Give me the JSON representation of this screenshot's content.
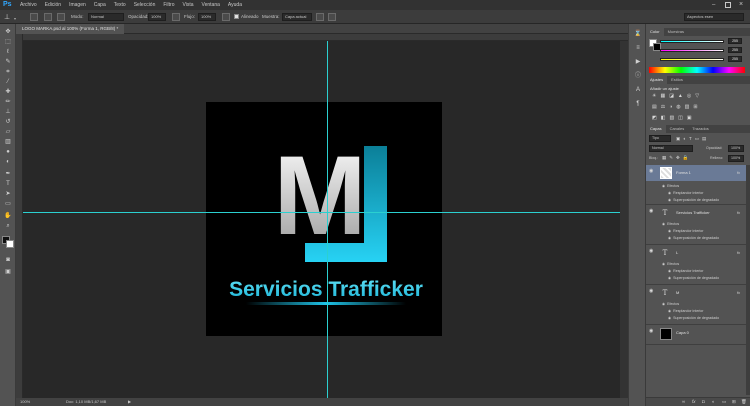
{
  "menubar": {
    "logo": "Ps",
    "items": [
      "Archivo",
      "Edición",
      "Imagen",
      "Capa",
      "Texto",
      "Selección",
      "Filtro",
      "Vista",
      "Ventana",
      "Ayuda"
    ]
  },
  "options": {
    "modo_label": "Modo:",
    "modo_value": "Normal",
    "opacidad_label": "Opacidad:",
    "opacidad_value": "100%",
    "flujo_label": "Flujo:",
    "flujo_value": "100%",
    "alineado_label": "Alineado",
    "muestra_label": "Muestra:",
    "muestra_value": "Capa actual",
    "workspace_value": "Aspectos esen"
  },
  "document": {
    "tab_title": "LOGO MARKA.psd al 100% (Forma 1, RGB/8) *",
    "zoom": "100%",
    "doc_info": "Doc: 1,10 MB/1,67 MB"
  },
  "artwork": {
    "mark_text": "M",
    "brand_text": "Servicios Trafficker"
  },
  "panels": {
    "color_tabs": [
      "Color",
      "Muestras"
    ],
    "color_values": [
      "255",
      "255",
      "255"
    ],
    "ajustes_tabs": [
      "Ajustes",
      "Estilos"
    ],
    "ajustes_title": "Añadir un ajuste",
    "layers_tabs": [
      "Capas",
      "Canales",
      "Trazados"
    ],
    "filter_kind": "Tipo",
    "blend_mode": "Normal",
    "opacity_label": "Opacidad:",
    "opacity_value": "100%",
    "lock_label": "Bloq.:",
    "fill_label": "Relleno:",
    "fill_value": "100%"
  },
  "layers": [
    {
      "name": "Forma 1",
      "kind": "shape",
      "fx": "fx",
      "selected": true,
      "effects_label": "Efectos",
      "effects": [
        "Resplandor interior",
        "Superposición de degradado"
      ]
    },
    {
      "name": "Servicios Trafficker",
      "kind": "text",
      "fx": "fx",
      "selected": false,
      "effects_label": "Efectos",
      "effects": [
        "Resplandor interior",
        "Superposición de degradado"
      ]
    },
    {
      "name": "L",
      "kind": "text",
      "fx": "fx",
      "selected": false,
      "effects_label": "Efectos",
      "effects": [
        "Resplandor interior",
        "Superposición de degradado"
      ]
    },
    {
      "name": "M",
      "kind": "text",
      "fx": "fx",
      "selected": false,
      "effects_label": "Efectos",
      "effects": [
        "Resplandor interior",
        "Superposición de degradado"
      ]
    },
    {
      "name": "Capa 0",
      "kind": "pixel",
      "fx": "",
      "selected": false,
      "effects_label": "",
      "effects": []
    }
  ],
  "colors": {
    "accent_cyan": "#1ec3e8",
    "guide": "#2bd0d0",
    "ps_blue": "#31a8ff",
    "selected_layer": "#6a7a96"
  }
}
